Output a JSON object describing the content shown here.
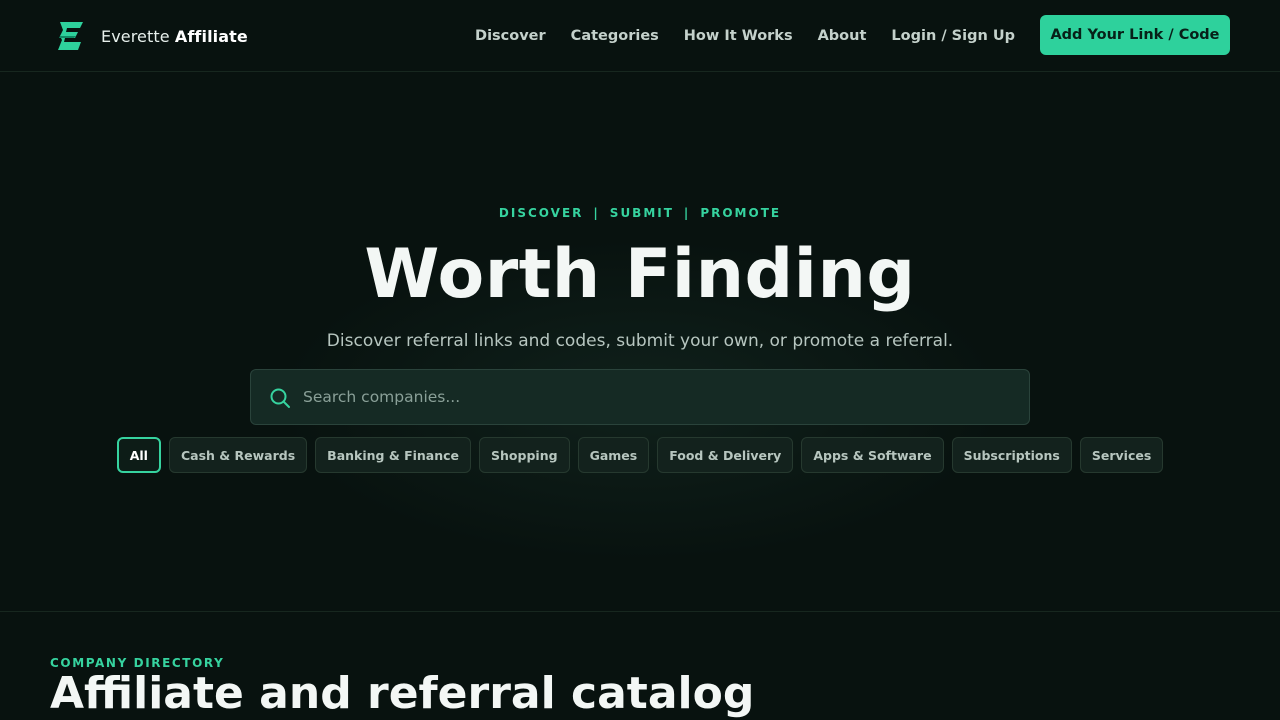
{
  "brand": {
    "name_light": "Everette",
    "name_bold": "Affiliate",
    "accent": "#2ed19c"
  },
  "nav": {
    "items": [
      {
        "label": "Discover"
      },
      {
        "label": "Categories"
      },
      {
        "label": "How It Works"
      },
      {
        "label": "About"
      },
      {
        "label": "Login / Sign Up"
      }
    ],
    "cta_label": "Add Your Link / Code"
  },
  "hero": {
    "eyebrow": [
      "DISCOVER",
      "SUBMIT",
      "PROMOTE"
    ],
    "separator": "|",
    "title": "Worth Finding",
    "subtitle": "Discover referral links and codes, submit your own, or promote a referral.",
    "search_placeholder": "Search companies...",
    "search_icon": "search-icon"
  },
  "categories": {
    "selected": "All",
    "items": [
      {
        "label": "All"
      },
      {
        "label": "Cash & Rewards"
      },
      {
        "label": "Banking & Finance"
      },
      {
        "label": "Shopping"
      },
      {
        "label": "Games"
      },
      {
        "label": "Food & Delivery"
      },
      {
        "label": "Apps & Software"
      },
      {
        "label": "Subscriptions"
      },
      {
        "label": "Services"
      }
    ]
  },
  "directory": {
    "eyebrow": "COMPANY DIRECTORY",
    "title": "Affiliate and referral catalog"
  }
}
